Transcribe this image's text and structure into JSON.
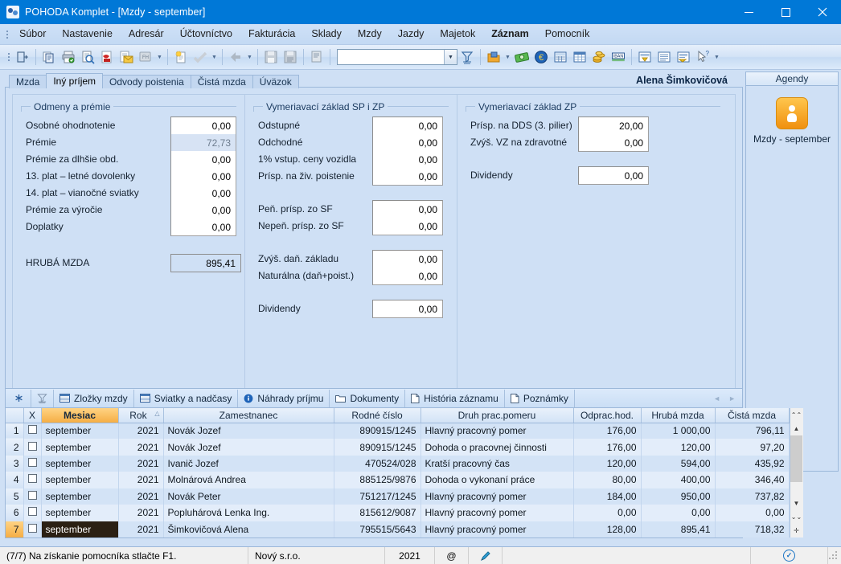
{
  "window": {
    "title": "POHODA Komplet - [Mzdy - september]",
    "minimize_label": "–",
    "maximize_label": "□",
    "close_label": "✕"
  },
  "menu": {
    "items": [
      {
        "label": "Súbor",
        "active": false
      },
      {
        "label": "Nastavenie",
        "active": false
      },
      {
        "label": "Adresár",
        "active": false
      },
      {
        "label": "Účtovníctvo",
        "active": false
      },
      {
        "label": "Fakturácia",
        "active": false
      },
      {
        "label": "Sklady",
        "active": false
      },
      {
        "label": "Mzdy",
        "active": false
      },
      {
        "label": "Jazdy",
        "active": false
      },
      {
        "label": "Majetok",
        "active": false
      },
      {
        "label": "Záznam",
        "active": true
      },
      {
        "label": "Pomocník",
        "active": false
      }
    ]
  },
  "toolbar": {
    "combo_value": "",
    "icons": [
      "exit-icon",
      "copy-records-icon",
      "print-icon",
      "print-preview-icon",
      "export-pdf-icon",
      "send-mail-icon",
      "edit-html-icon",
      "new-record-icon",
      "check-icon",
      "back-icon",
      "save-icon",
      "save-all-icon",
      "record-icon",
      "filter-icon",
      "agenda-icon",
      "money-icon",
      "euro-icon",
      "calculator-icon",
      "table-calc-icon",
      "coins-icon",
      "iban-icon",
      "form-icon",
      "list-icon",
      "preview-icon",
      "help-pointer-icon"
    ]
  },
  "form": {
    "tabs": [
      {
        "label": "Mzda",
        "active": false
      },
      {
        "label": "Iný príjem",
        "active": true
      },
      {
        "label": "Odvody poistenia",
        "active": false
      },
      {
        "label": "Čistá mzda",
        "active": false
      },
      {
        "label": "Úväzok",
        "active": false
      }
    ],
    "employee_name": "Alena Šimkovičová",
    "group1": {
      "title": "Odmeny a prémie",
      "fields": [
        {
          "label": "Osobné ohodnotenie",
          "value": "0,00",
          "readonly": false
        },
        {
          "label": "Prémie",
          "value": "72,73",
          "readonly": true
        },
        {
          "label": "Prémie za dlhšie obd.",
          "value": "0,00",
          "readonly": false,
          "combo": true,
          "combo_suffix": "q"
        },
        {
          "label": "13. plat – letné dovolenky",
          "value": "0,00",
          "readonly": false
        },
        {
          "label": "14. plat – vianočné sviatky",
          "value": "0,00",
          "readonly": false
        },
        {
          "label": "Prémie za výročie",
          "value": "0,00",
          "readonly": false
        },
        {
          "label": "Doplatky",
          "value": "0,00",
          "readonly": false
        }
      ],
      "total_label": "HRUBÁ MZDA",
      "total_value": "895,41"
    },
    "group2": {
      "title": "Vymeriavací základ SP i ZP",
      "block1": [
        {
          "label": "Odstupné",
          "value": "0,00"
        },
        {
          "label": "Odchodné",
          "value": "0,00"
        },
        {
          "label": "1% vstup. ceny vozidla",
          "value": "0,00"
        },
        {
          "label": "Prísp. na živ. poistenie",
          "value": "0,00"
        }
      ],
      "block2": [
        {
          "label": "Peň. prísp. zo SF",
          "value": "0,00"
        },
        {
          "label": "Nepeň. prísp. zo SF",
          "value": "0,00"
        }
      ],
      "block3": [
        {
          "label": "Zvýš. daň. základu",
          "value": "0,00"
        },
        {
          "label": "Naturálna (daň+poist.)",
          "value": "0,00"
        }
      ],
      "block4": [
        {
          "label": "Dividendy",
          "value": "0,00"
        }
      ]
    },
    "group3": {
      "title": "Vymeriavací základ ZP",
      "block1": [
        {
          "label": "Prísp. na DDS (3. pilier)",
          "value": "20,00"
        },
        {
          "label": "Zvýš. VZ na zdravotné",
          "value": "0,00"
        }
      ],
      "block2": [
        {
          "label": "Dividendy",
          "value": "0,00"
        }
      ]
    }
  },
  "dock": {
    "header": "Agendy",
    "item_label": "Mzdy - september",
    "item_icon": "person-agenda-icon"
  },
  "bottom_tabs": {
    "items": [
      {
        "label": "",
        "icon": "asterisk-icon"
      },
      {
        "label": "",
        "icon": "filter-icon"
      },
      {
        "label": "Zložky mzdy",
        "icon": "table-icon"
      },
      {
        "label": "Sviatky a nadčasy",
        "icon": "table-icon"
      },
      {
        "label": "Náhrady príjmu",
        "icon": "info-icon"
      },
      {
        "label": "Dokumenty",
        "icon": "folder-icon"
      },
      {
        "label": "História záznamu",
        "icon": "document-icon"
      },
      {
        "label": "Poznámky",
        "icon": "document-icon"
      }
    ],
    "nav_prev": "◄",
    "nav_next": "►"
  },
  "table": {
    "columns": [
      "",
      "X",
      "Mesiac",
      "Rok",
      "Zamestnanec",
      "Rodné číslo",
      "Druh prac.pomeru",
      "Odprac.hod.",
      "Hrubá mzda",
      "Čistá mzda",
      ""
    ],
    "sort_column": "Rok",
    "sort_indicator": "△",
    "rows": [
      {
        "idx": "1",
        "month": "september",
        "year": "2021",
        "employee": "Novák Jozef",
        "birth_number": "890915/1245",
        "contract": "Hlavný pracovný pomer",
        "hours": "176,00",
        "gross": "1 000,00",
        "net": "796,11",
        "selected": false
      },
      {
        "idx": "2",
        "month": "september",
        "year": "2021",
        "employee": "Novák Jozef",
        "birth_number": "890915/1245",
        "contract": "Dohoda o pracovnej činnosti",
        "hours": "176,00",
        "gross": "120,00",
        "net": "97,20",
        "selected": false
      },
      {
        "idx": "3",
        "month": "september",
        "year": "2021",
        "employee": "Ivanič Jozef",
        "birth_number": "470524/028",
        "contract": "Kratší pracovný čas",
        "hours": "120,00",
        "gross": "594,00",
        "net": "435,92",
        "selected": false
      },
      {
        "idx": "4",
        "month": "september",
        "year": "2021",
        "employee": "Molnárová Andrea",
        "birth_number": "885125/9876",
        "contract": "Dohoda o vykonaní práce",
        "hours": "80,00",
        "gross": "400,00",
        "net": "346,40",
        "selected": false
      },
      {
        "idx": "5",
        "month": "september",
        "year": "2021",
        "employee": "Novák Peter",
        "birth_number": "751217/1245",
        "contract": "Hlavný pracovný pomer",
        "hours": "184,00",
        "gross": "950,00",
        "net": "737,82",
        "selected": false
      },
      {
        "idx": "6",
        "month": "september",
        "year": "2021",
        "employee": "Popluhárová Lenka Ing.",
        "birth_number": "815612/9087",
        "contract": "Hlavný pracovný pomer",
        "hours": "0,00",
        "gross": "0,00",
        "net": "0,00",
        "selected": false
      },
      {
        "idx": "7",
        "month": "september",
        "year": "2021",
        "employee": "Šimkovičová Alena",
        "birth_number": "795515/5643",
        "contract": "Hlavný pracovný pomer",
        "hours": "128,00",
        "gross": "895,41",
        "net": "718,32",
        "selected": true
      }
    ]
  },
  "statusbar": {
    "message": "(7/7) Na získanie pomocníka stlačte F1.",
    "company": "Nový s.r.o.",
    "year": "2021",
    "at_symbol": "@",
    "pen_icon": "pen-icon",
    "ok_icon": "check-circle-icon"
  },
  "colors": {
    "title_bar": "#0078d7",
    "accent_orange": "#f5ae45",
    "form_bg": "#cfe0f5",
    "grid_row_odd": "#d3e3f6",
    "grid_row_even": "#e3edfa",
    "selection_dark": "#2b2013"
  }
}
